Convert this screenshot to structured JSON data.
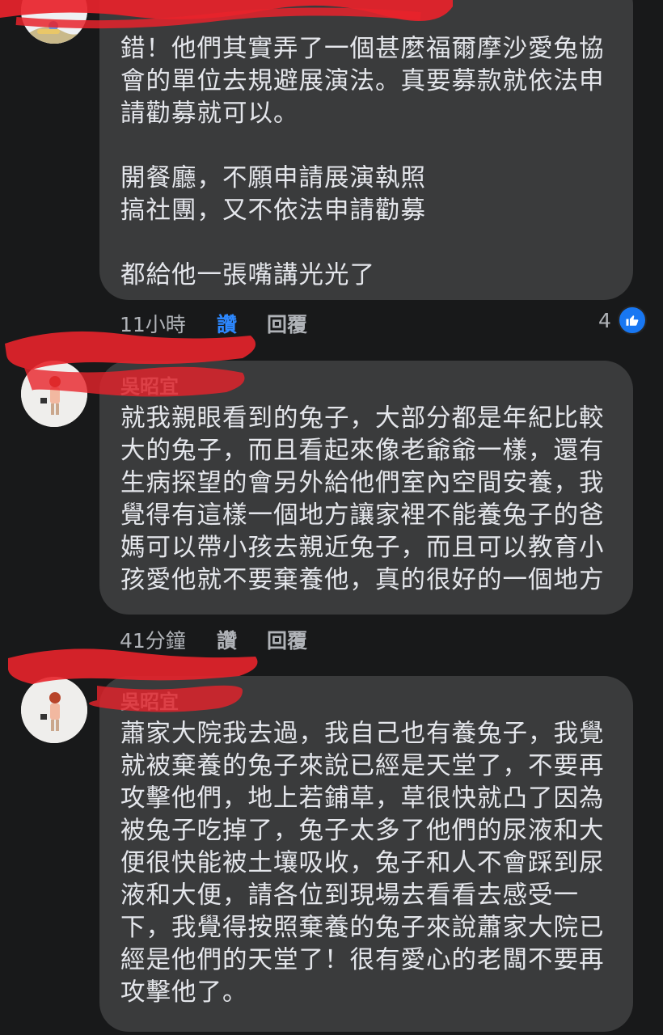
{
  "comments": [
    {
      "name": "",
      "lines": [
        "錯！他們其實弄了一個甚麼福爾摩沙愛兔協",
        "會的單位去規避展演法。真要募款就依法申",
        "請勸募就可以。",
        "",
        "開餐廳，不願申請展演執照",
        "搞社團，又不依法申請勸募",
        "",
        "都給他一張嘴講光光了"
      ],
      "time": "11小時",
      "like_label": "讚",
      "reply_label": "回覆",
      "reaction_count": "4"
    },
    {
      "name": "吳昭宜",
      "lines": [
        "就我親眼看到的兔子，大部分都是年紀比較",
        "大的兔子，而且看起來像老爺爺一樣，還有",
        "生病探望的會另外給他們室內空間安養，我",
        "覺得有這樣一個地方讓家裡不能養兔子的爸",
        "媽可以帶小孩去親近兔子，而且可以教育小",
        "孩愛他就不要棄養他，真的很好的一個地方"
      ],
      "time": "41分鐘",
      "like_label": "讚",
      "reply_label": "回覆"
    },
    {
      "name": "吳昭宜",
      "lines": [
        "蕭家大院我去過，我自己也有養兔子，我覺",
        "就被棄養的兔子來說已經是天堂了，不要再",
        "攻擊他們，地上若鋪草，草很快就凸了因為",
        "被兔子吃掉了，兔子太多了他們的尿液和大",
        "便很快能被土壤吸收，兔子和人不會踩到尿",
        "液和大便，請各位到現場去看看去感受一",
        "下，我覺得按照棄養的兔子來說蕭家大院已",
        "經是他們的天堂了！很有愛心的老闆不要再",
        "攻擊他了。"
      ]
    }
  ],
  "colors": {
    "background": "#18191a",
    "bubble": "#3a3b3c",
    "text": "#e4e6eb",
    "meta": "#b0b3b8",
    "accent": "#2d88ff",
    "redaction": "#e8232b"
  },
  "icons": {
    "reaction": "like-thumb-icon"
  }
}
